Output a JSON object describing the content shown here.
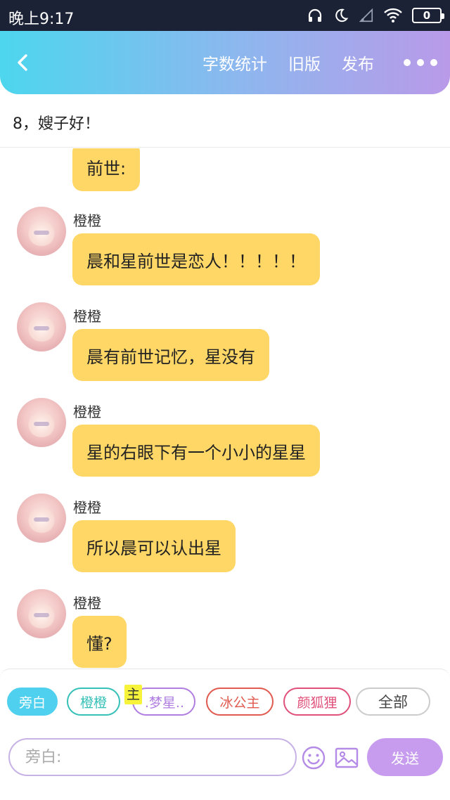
{
  "status_bar": {
    "time": "晚上9:17",
    "battery": "0",
    "icons": [
      "headphones-icon",
      "moon-icon",
      "signal-icon",
      "wifi-icon",
      "battery-icon"
    ]
  },
  "header": {
    "back_icon": "back-icon",
    "word_count_label": "字数统计",
    "old_version_label": "旧版",
    "publish_label": "发布",
    "more_icon": "more-icon",
    "colors": {
      "start": "#4dd6ee",
      "end": "#b99ae9"
    }
  },
  "title": "8，嫂子好！",
  "messages": [
    {
      "sender": "",
      "text": "前世:"
    },
    {
      "sender": "橙橙",
      "text": "晨和星前世是恋人！！！！！"
    },
    {
      "sender": "橙橙",
      "text": "晨有前世记忆，星没有"
    },
    {
      "sender": "橙橙",
      "text": "星的右眼下有一个小小的星星"
    },
    {
      "sender": "橙橙",
      "text": "所以晨可以认出星"
    },
    {
      "sender": "橙橙",
      "text": "懂?"
    }
  ],
  "bubble_color": "#ffd766",
  "characters": [
    {
      "label": "旁白",
      "color": "#4fd0ef",
      "active": true
    },
    {
      "label": "橙橙",
      "color": "#35c0b8",
      "active": false
    },
    {
      "label": ".梦星..",
      "badge": "主",
      "color": "#b07ee0",
      "active": false
    },
    {
      "label": "冰公主",
      "color": "#e05a4f",
      "active": false
    },
    {
      "label": "颜狐狸",
      "color": "#e0507a",
      "active": false
    },
    {
      "label": "全部",
      "color": "#444444",
      "active": false
    }
  ],
  "composer": {
    "placeholder": "旁白:",
    "emoji_icon": "emoji-icon",
    "image_icon": "image-icon",
    "send_label": "发送"
  }
}
